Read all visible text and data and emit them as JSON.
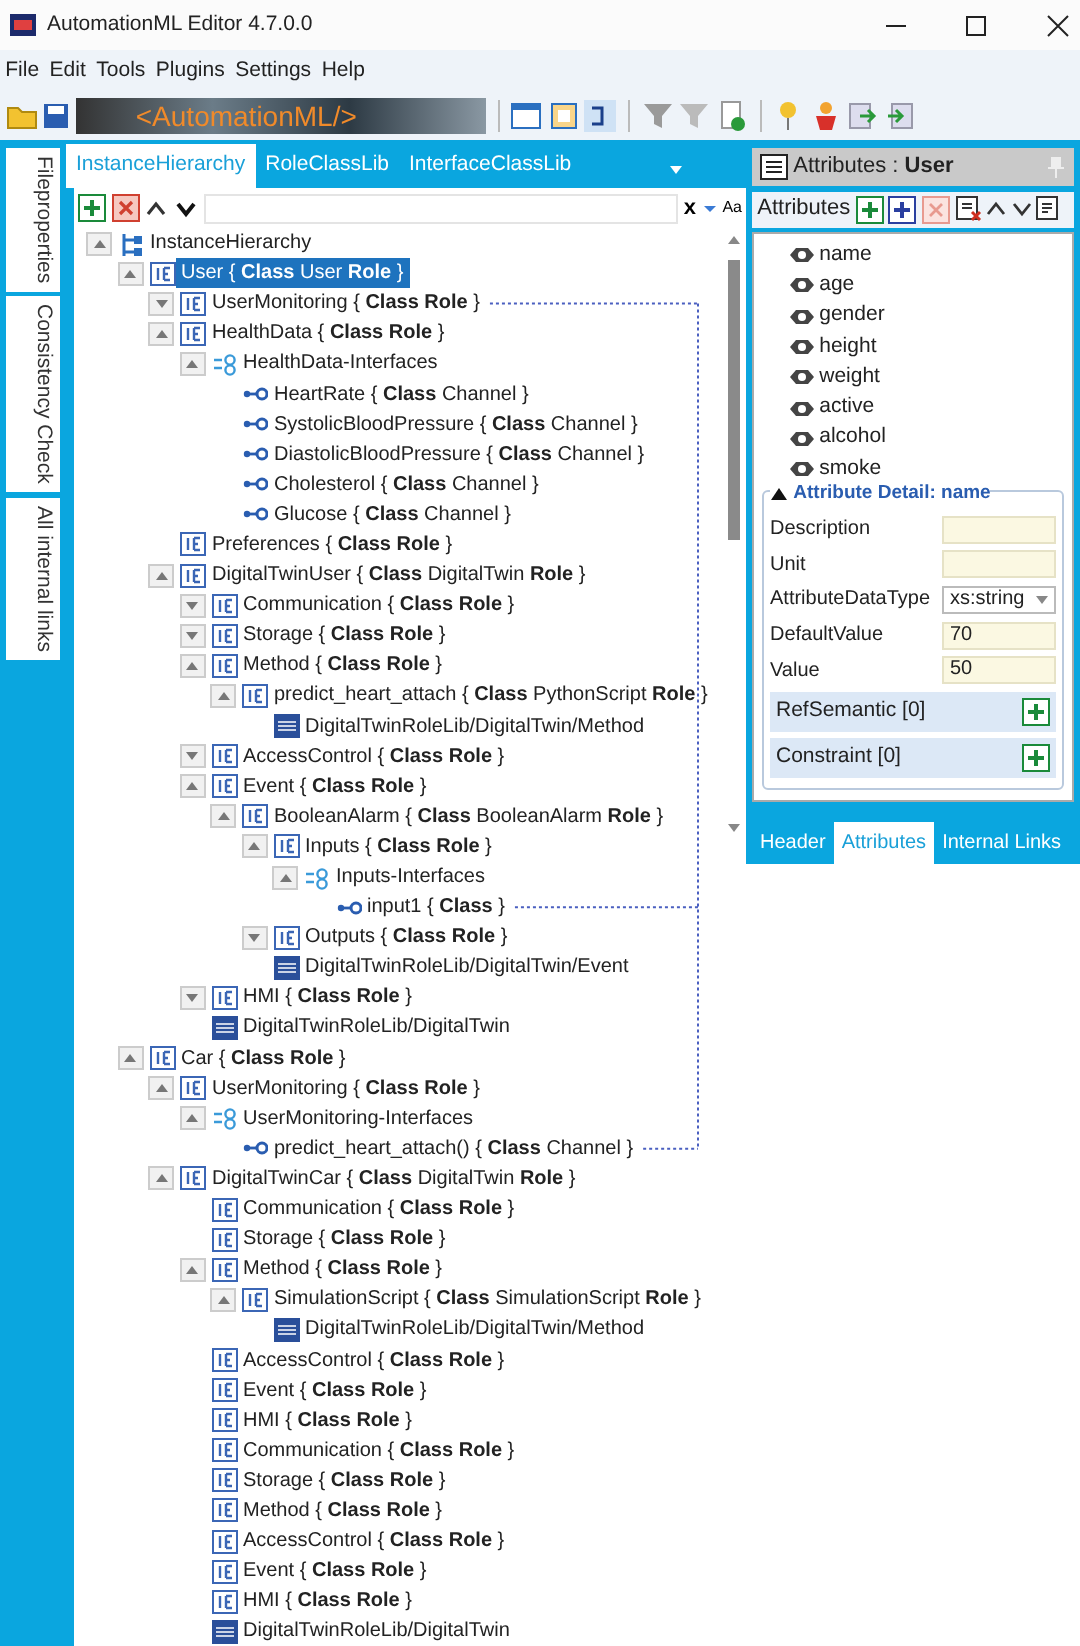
{
  "window": {
    "title": "AutomationML Editor 4.7.0.0"
  },
  "menu": [
    "File",
    "Edit",
    "Tools",
    "Plugins",
    "Settings",
    "Help"
  ],
  "toolbar": {
    "logo": "<AutomationML/>"
  },
  "side_tabs": [
    "Fileproperties",
    "Consistency Check",
    "All internal links"
  ],
  "hierarchy_panel": {
    "tabs": [
      {
        "label": "InstanceHierarchy",
        "selected": true
      },
      {
        "label": "RoleClassLib",
        "selected": false
      },
      {
        "label": "InterfaceClassLib",
        "selected": false
      }
    ],
    "search": {
      "clear": "x",
      "case": "Aa"
    },
    "tree": [
      {
        "kind": "hierarchy",
        "text": "InstanceHierarchy",
        "expanded": true,
        "selected": false,
        "children": [
          {
            "kind": "ie",
            "text": "User { **Class** User **Role** }",
            "expanded": true,
            "selected": true,
            "children": [
              {
                "kind": "ie",
                "text": "UserMonitoring { **Class** **Role** }",
                "expanded": false,
                "selected": false,
                "linked": true
              },
              {
                "kind": "ie",
                "text": "HealthData { **Class** **Role** }",
                "expanded": true,
                "selected": false,
                "children": [
                  {
                    "kind": "interfaces",
                    "text": "HealthData-Interfaces",
                    "expanded": true,
                    "selected": false,
                    "children": [
                      {
                        "kind": "interface",
                        "text": "HeartRate { **Class** Channel }",
                        "selected": false
                      },
                      {
                        "kind": "interface",
                        "text": "SystolicBloodPressure { **Class** Channel }",
                        "selected": false
                      },
                      {
                        "kind": "interface",
                        "text": "DiastolicBloodPressure { **Class** Channel }",
                        "selected": false
                      },
                      {
                        "kind": "interface",
                        "text": "Cholesterol { **Class** Channel }",
                        "selected": false
                      },
                      {
                        "kind": "interface",
                        "text": "Glucose { **Class** Channel }",
                        "selected": false
                      }
                    ]
                  }
                ]
              },
              {
                "kind": "ie",
                "text": "Preferences { **Class** **Role** }",
                "selected": false
              },
              {
                "kind": "ie",
                "text": "DigitalTwinUser { **Class** DigitalTwin **Role** }",
                "expanded": true,
                "selected": false,
                "children": [
                  {
                    "kind": "ie",
                    "text": "Communication { **Class** **Role** }",
                    "expanded": false,
                    "selected": false
                  },
                  {
                    "kind": "ie",
                    "text": "Storage { **Class** **Role** }",
                    "expanded": false,
                    "selected": false
                  },
                  {
                    "kind": "ie",
                    "text": "Method { **Class** **Role** }",
                    "expanded": true,
                    "selected": false,
                    "children": [
                      {
                        "kind": "ie",
                        "text": "predict_heart_attach { **Class** PythonScript **Role** }",
                        "expanded": true,
                        "selected": false,
                        "children": [
                          {
                            "kind": "src",
                            "text": "DigitalTwinRoleLib/DigitalTwin/Method",
                            "selected": false
                          }
                        ]
                      }
                    ]
                  },
                  {
                    "kind": "ie",
                    "text": "AccessControl { **Class** **Role** }",
                    "expanded": false,
                    "selected": false
                  },
                  {
                    "kind": "ie",
                    "text": "Event { **Class** **Role** }",
                    "expanded": true,
                    "selected": false,
                    "children": [
                      {
                        "kind": "ie",
                        "text": "BooleanAlarm { **Class** BooleanAlarm **Role** }",
                        "expanded": true,
                        "selected": false,
                        "children": [
                          {
                            "kind": "ie",
                            "text": "Inputs { **Class** **Role** }",
                            "expanded": true,
                            "selected": false,
                            "children": [
                              {
                                "kind": "interfaces",
                                "text": "Inputs-Interfaces",
                                "expanded": true,
                                "selected": false,
                                "children": [
                                  {
                                    "kind": "interface",
                                    "text": "input1 { **Class** }",
                                    "selected": false,
                                    "linked": true
                                  }
                                ]
                              }
                            ]
                          },
                          {
                            "kind": "ie",
                            "text": "Outputs { **Class** **Role** }",
                            "expanded": false,
                            "selected": false
                          },
                          {
                            "kind": "src",
                            "text": "DigitalTwinRoleLib/DigitalTwin/Event",
                            "selected": false
                          }
                        ]
                      }
                    ]
                  },
                  {
                    "kind": "ie",
                    "text": "HMI { **Class** **Role** }",
                    "expanded": false,
                    "selected": false
                  },
                  {
                    "kind": "src",
                    "text": "DigitalTwinRoleLib/DigitalTwin",
                    "selected": false
                  }
                ]
              }
            ]
          },
          {
            "kind": "ie",
            "text": "Car { **Class** **Role** }",
            "expanded": true,
            "selected": false,
            "children": [
              {
                "kind": "ie",
                "text": "UserMonitoring { **Class** **Role** }",
                "expanded": true,
                "selected": false,
                "children": [
                  {
                    "kind": "interfaces",
                    "text": "UserMonitoring-Interfaces",
                    "expanded": true,
                    "selected": false,
                    "children": [
                      {
                        "kind": "interface",
                        "text": "predict_heart_attach() { **Class** Channel }",
                        "selected": false,
                        "linked": true
                      }
                    ]
                  }
                ]
              },
              {
                "kind": "ie",
                "text": "DigitalTwinCar { **Class** DigitalTwin **Role** }",
                "expanded": true,
                "selected": false,
                "children": [
                  {
                    "kind": "ie",
                    "text": "Communication { **Class** **Role** }",
                    "selected": false
                  },
                  {
                    "kind": "ie",
                    "text": "Storage { **Class** **Role** }",
                    "selected": false
                  },
                  {
                    "kind": "ie",
                    "text": "Method { **Class** **Role** }",
                    "expanded": true,
                    "selected": false,
                    "children": [
                      {
                        "kind": "ie",
                        "text": "SimulationScript { **Class** SimulationScript **Role** }",
                        "expanded": true,
                        "selected": false,
                        "children": [
                          {
                            "kind": "src",
                            "text": "DigitalTwinRoleLib/DigitalTwin/Method",
                            "selected": false
                          }
                        ]
                      }
                    ]
                  },
                  {
                    "kind": "ie",
                    "text": "AccessControl { **Class** **Role** }",
                    "selected": false
                  },
                  {
                    "kind": "ie",
                    "text": "Event { **Class** **Role** }",
                    "selected": false
                  },
                  {
                    "kind": "ie",
                    "text": "HMI { **Class** **Role** }",
                    "selected": false
                  },
                  {
                    "kind": "ie",
                    "text": "Communication { **Class** **Role** }",
                    "selected": false
                  },
                  {
                    "kind": "ie",
                    "text": "Storage { **Class** **Role** }",
                    "selected": false
                  },
                  {
                    "kind": "ie",
                    "text": "Method { **Class** **Role** }",
                    "selected": false
                  },
                  {
                    "kind": "ie",
                    "text": "AccessControl { **Class** **Role** }",
                    "selected": false
                  },
                  {
                    "kind": "ie",
                    "text": "Event { **Class** **Role** }",
                    "selected": false
                  },
                  {
                    "kind": "ie",
                    "text": "HMI { **Class** **Role** }",
                    "selected": false
                  },
                  {
                    "kind": "src",
                    "text": "DigitalTwinRoleLib/DigitalTwin",
                    "selected": false
                  }
                ]
              }
            ]
          }
        ]
      }
    ]
  },
  "attributes_panel": {
    "title": "Attributes : **User**",
    "toolbar_label": "Attributes",
    "items": [
      "name",
      "age",
      "gender",
      "height",
      "weight",
      "active",
      "alcohol",
      "smoke"
    ],
    "detail": {
      "title": "Attribute Detail: name",
      "expanded": true,
      "fields": [
        {
          "label": "Description",
          "kind": "text"
        },
        {
          "label": "Unit",
          "kind": "text"
        },
        {
          "label": "AttributeDataType",
          "kind": "select",
          "value": "xs:string"
        },
        {
          "label": "DefaultValue",
          "kind": "text",
          "value": "70"
        },
        {
          "label": "Value",
          "kind": "text",
          "value": "50"
        }
      ]
    },
    "sections": [
      "RefSemantic [0]",
      "Constraint [0]"
    ],
    "tabs": [
      {
        "label": "Header",
        "selected": false
      },
      {
        "label": "Attributes",
        "selected": true
      },
      {
        "label": "Internal Links",
        "selected": false
      }
    ]
  }
}
